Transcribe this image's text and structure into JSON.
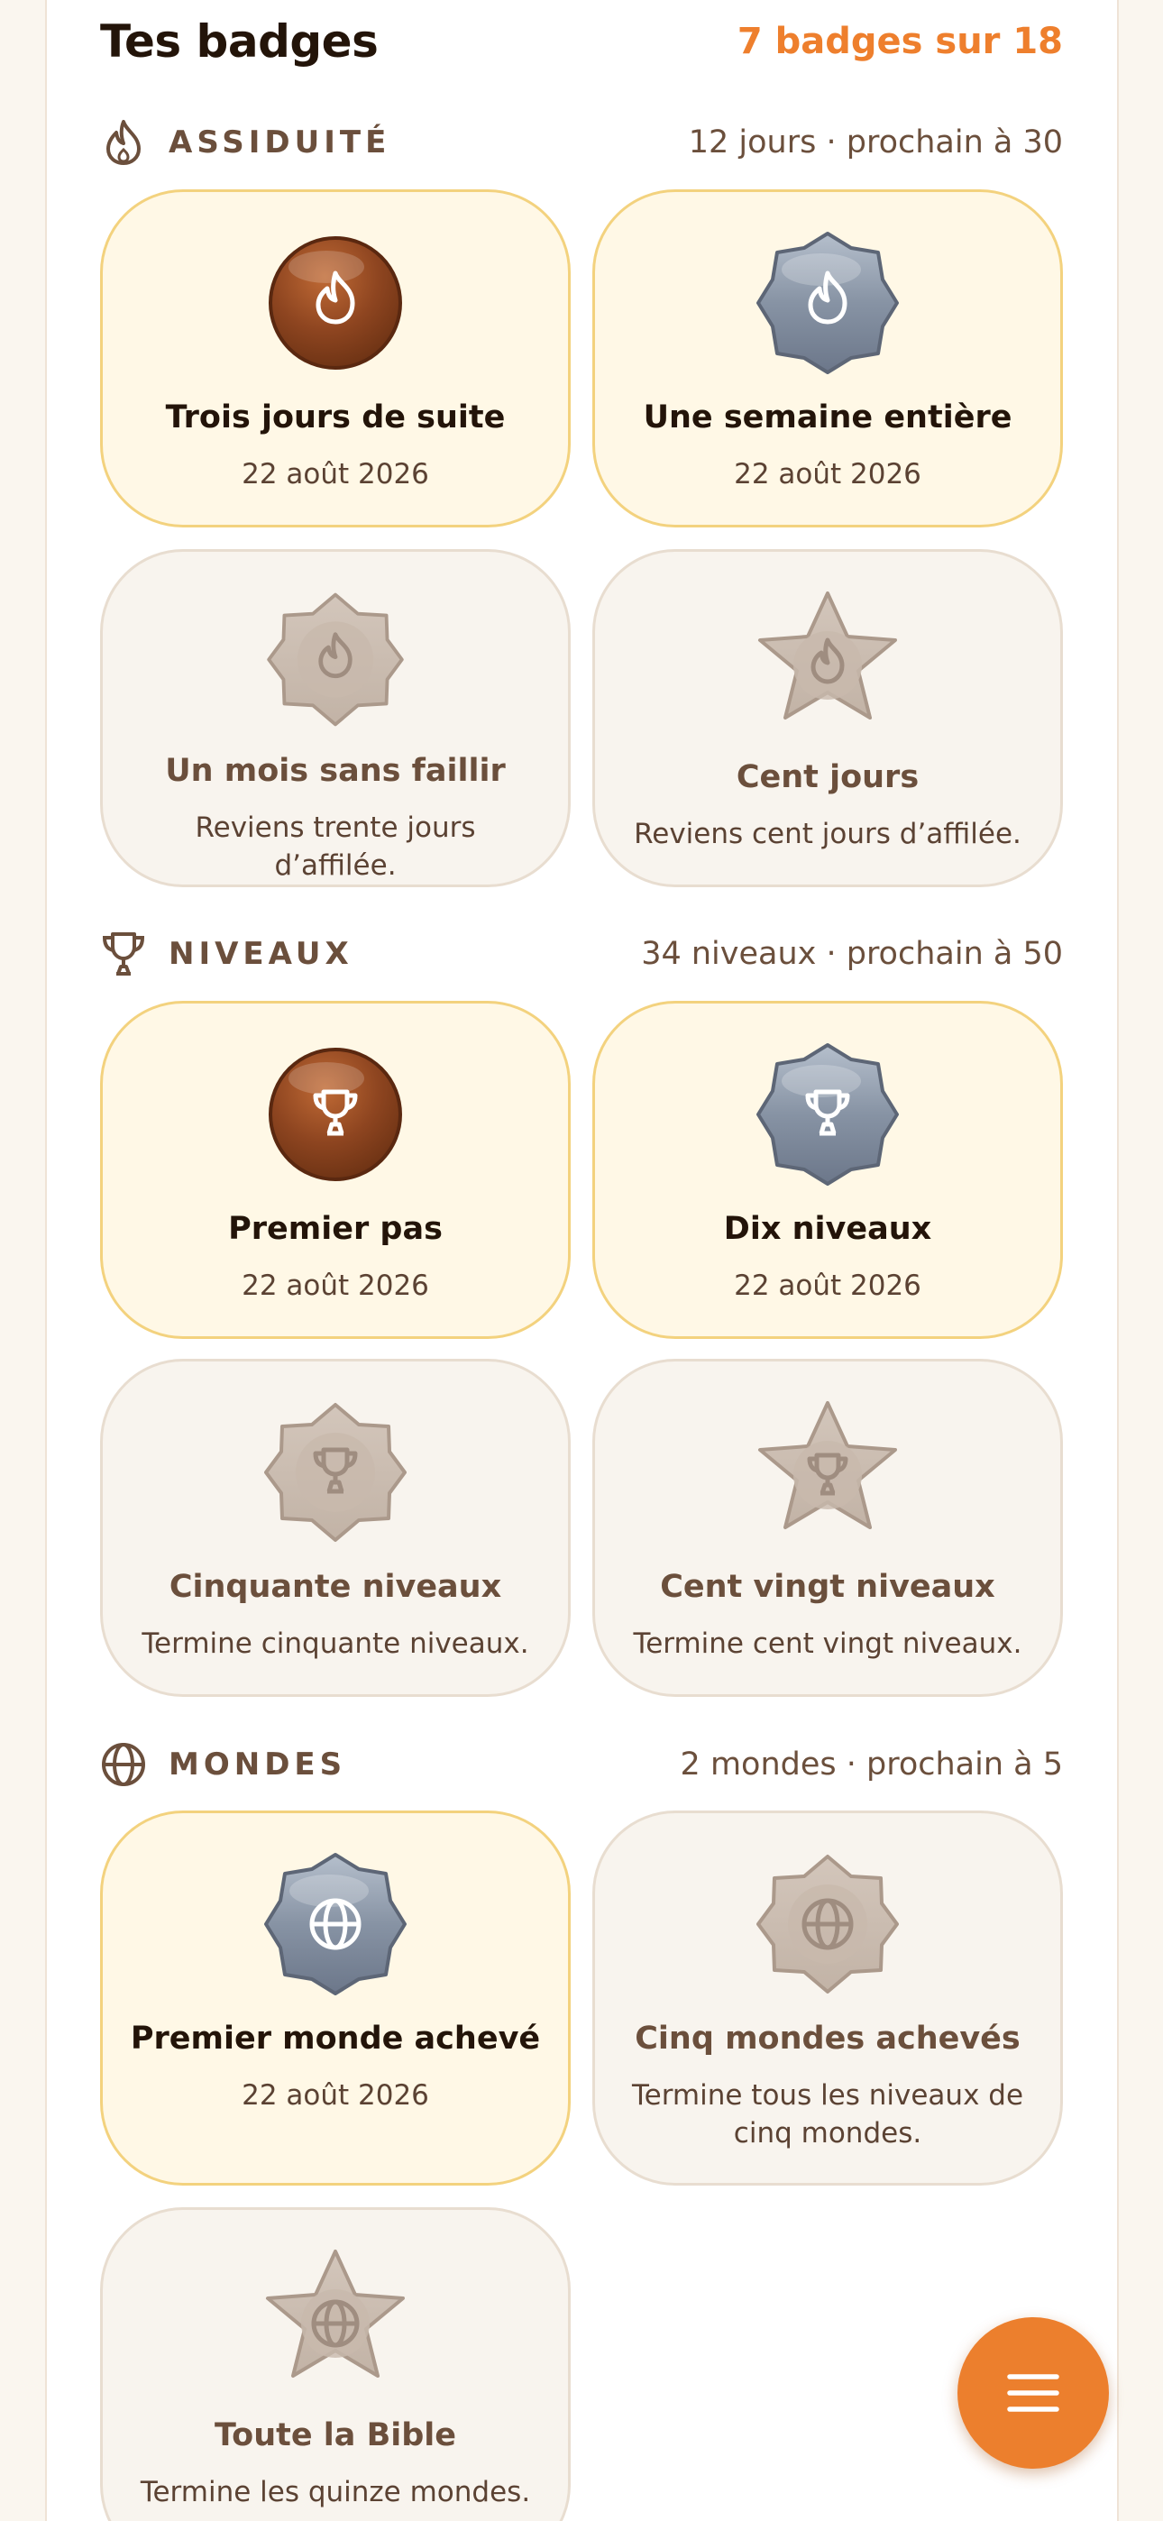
{
  "header": {
    "title": "Tes badges",
    "count": "7 badges sur 18"
  },
  "colors": {
    "accent": "#ee7f2d",
    "bronze": "#8a4620",
    "silver": "#7d8797",
    "locked": "#bfaea0",
    "unlocked_bg": "#fff8e6",
    "unlocked_border": "#f3d27e"
  },
  "sections": [
    {
      "title": "ASSIDUITÉ",
      "icon": "flame-icon",
      "progress": "12 jours · prochain à 30",
      "badges": [
        {
          "name": "Trois jours de suite",
          "detail": "22 août 2026",
          "tier": "bronze",
          "unlocked": true
        },
        {
          "name": "Une semaine entière",
          "detail": "22 août 2026",
          "tier": "silver",
          "unlocked": true
        },
        {
          "name": "Un mois sans faillir",
          "detail": "Reviens trente jours d’affilée.",
          "tier": "gold",
          "unlocked": false
        },
        {
          "name": "Cent jours",
          "detail": "Reviens cent jours d’affilée.",
          "tier": "platinum",
          "unlocked": false
        }
      ]
    },
    {
      "title": "NIVEAUX",
      "icon": "trophy-icon",
      "progress": "34 niveaux · prochain à 50",
      "badges": [
        {
          "name": "Premier pas",
          "detail": "22 août 2026",
          "tier": "bronze",
          "unlocked": true
        },
        {
          "name": "Dix niveaux",
          "detail": "22 août 2026",
          "tier": "silver",
          "unlocked": true
        },
        {
          "name": "Cinquante niveaux",
          "detail": "Termine cinquante niveaux.",
          "tier": "gold",
          "unlocked": false
        },
        {
          "name": "Cent vingt niveaux",
          "detail": "Termine cent vingt niveaux.",
          "tier": "platinum",
          "unlocked": false
        }
      ]
    },
    {
      "title": "MONDES",
      "icon": "globe-icon",
      "progress": "2 mondes · prochain à 5",
      "badges": [
        {
          "name": "Premier monde achevé",
          "detail": "22 août 2026",
          "tier": "silver",
          "unlocked": true
        },
        {
          "name": "Cinq mondes achevés",
          "detail": "Termine tous les niveaux de cinq mondes.",
          "tier": "gold",
          "unlocked": false
        },
        {
          "name": "Toute la Bible",
          "detail": "Termine les quinze mondes.",
          "tier": "platinum",
          "unlocked": false
        }
      ]
    }
  ],
  "fab": {
    "icon": "menu-icon"
  }
}
